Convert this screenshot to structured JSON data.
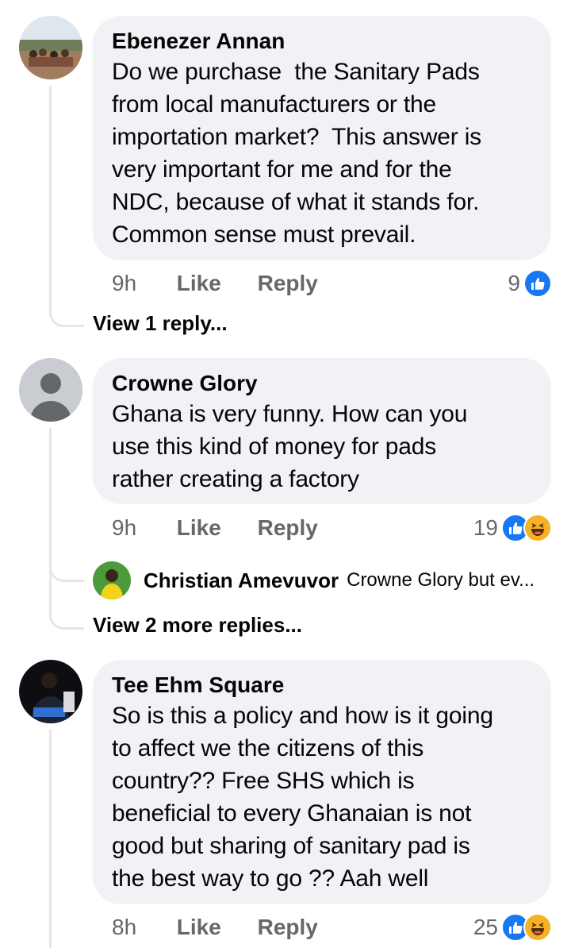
{
  "comments": [
    {
      "author": "Ebenezer Annan",
      "text": "Do we purchase  the Sanitary Pads\nfrom local manufacturers or the\nimportation market?  This answer is\nvery important for me and for the\nNDC, because of what it stands for.\nCommon sense must prevail.",
      "time": "9h",
      "like_label": "Like",
      "reply_label": "Reply",
      "reaction_count": "9",
      "reactions": [
        "like-icon"
      ],
      "view_replies": "View 1 reply..."
    },
    {
      "author": "Crowne Glory",
      "text": "Ghana is very funny. How can you\nuse this kind of money for pads\nrather creating a factory",
      "time": "9h",
      "like_label": "Like",
      "reply_label": "Reply",
      "reaction_count": "19",
      "reactions": [
        "like-icon",
        "haha-icon"
      ],
      "reply_preview": {
        "author": "Christian Amevuvor",
        "text": "Crowne Glory but ev..."
      },
      "view_replies": "View 2 more replies..."
    },
    {
      "author": "Tee Ehm Square",
      "text": "So is this a policy and how is it going\nto affect we the citizens of this\ncountry?? Free SHS which is\nbeneficial to every Ghanaian is not\ngood but sharing of sanitary pad is\nthe best way to go ?? Aah well",
      "time": "8h",
      "like_label": "Like",
      "reply_label": "Reply",
      "reaction_count": "25",
      "reactions": [
        "like-icon",
        "haha-icon"
      ]
    }
  ],
  "colors": {
    "bubble": "#f0f2f5",
    "meta_text": "#65676b",
    "like_blue": "#1877f2",
    "haha_yellow": "#f7b125",
    "thread_line": "#e4e6eb"
  }
}
